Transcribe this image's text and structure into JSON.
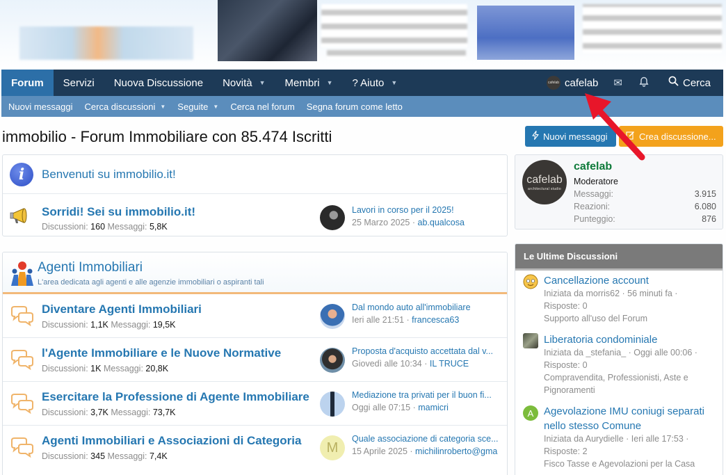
{
  "nav": {
    "tabs": [
      {
        "label": "Forum",
        "active": true,
        "caret": false
      },
      {
        "label": "Servizi",
        "active": false,
        "caret": false
      },
      {
        "label": "Nuova Discussione",
        "active": false,
        "caret": false
      },
      {
        "label": "Novità",
        "active": false,
        "caret": true
      },
      {
        "label": "Membri",
        "active": false,
        "caret": true
      },
      {
        "label": "? Aiuto",
        "active": false,
        "caret": true
      }
    ],
    "user": "cafelab",
    "search_label": "Cerca"
  },
  "subnav": {
    "items": [
      "Nuovi messaggi",
      "Cerca discussioni",
      "Seguite",
      "Cerca nel forum",
      "Segna forum come letto"
    ]
  },
  "page": {
    "title": "immobilio - Forum Immobiliare con 85.474 Iscritti",
    "btn_new_messages": "Nuovi messaggi",
    "btn_create_thread": "Crea discussione..."
  },
  "welcome": {
    "title": "Benvenuti su immobilio.it!",
    "node": {
      "title": "Sorridi! Sei su immobilio.it!",
      "discussions_label": "Discussioni:",
      "discussions": "160",
      "messages_label": "Messaggi:",
      "messages": "5,8K",
      "last_title": "Lavori in corso per il 2025!",
      "last_date": "25 Marzo 2025",
      "last_user": "ab.qualcosa"
    }
  },
  "category": {
    "title": "Agenti Immobiliari",
    "description": "L'area dedicata agli agenti e alle agenzie immobiliari o aspiranti tali",
    "nodes": [
      {
        "title": "Diventare Agenti Immobiliari",
        "discussions": "1,1K",
        "messages": "19,5K",
        "last_title": "Dal mondo auto all'immobiliare",
        "last_date": "Ieri alle 21:51",
        "last_user": "francesca63"
      },
      {
        "title": "l'Agente Immobiliare e le Nuove Normative",
        "discussions": "1K",
        "messages": "20,8K",
        "last_title": "Proposta d'acquisto accettata dal v...",
        "last_date": "Giovedì alle 10:34",
        "last_user": "IL TRUCE"
      },
      {
        "title": "Esercitare la Professione di Agente Immobiliare",
        "discussions": "3,7K",
        "messages": "73,7K",
        "last_title": "Mediazione tra privati per il buon fi...",
        "last_date": "Oggi alle 07:15",
        "last_user": "mamicri"
      },
      {
        "title": "Agenti Immobiliari e Associazioni di Categoria",
        "discussions": "345",
        "messages": "7,4K",
        "last_title": "Quale associazione di categoria sce...",
        "last_date": "15 Aprile 2025",
        "last_user": "michilinroberto@gma"
      }
    ],
    "discussions_label": "Discussioni:",
    "messages_label": "Messaggi:"
  },
  "profile": {
    "avatar_brand": "cafelab",
    "avatar_sub": "architectural studio",
    "name": "cafelab",
    "role": "Moderatore",
    "stats": [
      {
        "label": "Messaggi:",
        "value": "3.915"
      },
      {
        "label": "Reazioni:",
        "value": "6.080"
      },
      {
        "label": "Punteggio:",
        "value": "876"
      }
    ]
  },
  "latest": {
    "heading": "Le Ultime Discussioni",
    "threads": [
      {
        "title": "Cancellazione account",
        "started": "Iniziata da morris62 · 56 minuti fa ·",
        "replies": "Risposte: 0",
        "forum": "Supporto all'uso del Forum"
      },
      {
        "title": "Liberatoria condominiale",
        "started": "Iniziata da _stefania_ · Oggi alle 00:06 ·",
        "replies": "Risposte: 0",
        "forum": "Compravendita, Professionisti, Aste e Pignoramenti"
      },
      {
        "title": "Agevolazione IMU coniugi separati nello stesso Comune",
        "started": "Iniziata da Aurydielle · Ieri alle 17:53 ·",
        "replies": "Risposte: 2",
        "forum": "Fisco Tasse e Agevolazioni per la Casa",
        "avatar_letter": "A"
      }
    ]
  },
  "colors": {
    "nav_bg": "#1d3a57",
    "nav_active": "#2c6fa8",
    "subnav_bg": "#5b8dbc",
    "link": "#2577b1",
    "button_blue": "#2577b1",
    "button_orange": "#f3a21c",
    "profile_name": "#0e7a3a",
    "arrow": "#e8162a"
  }
}
